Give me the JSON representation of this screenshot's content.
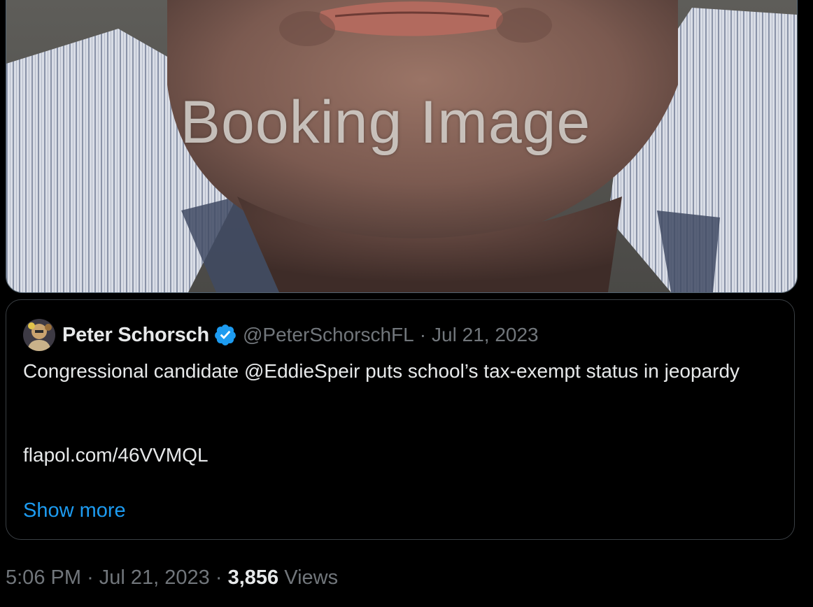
{
  "media": {
    "watermark_text": "Booking Image"
  },
  "quoted_tweet": {
    "author_name": "Peter Schorsch",
    "handle": "@PeterSchorschFL",
    "separator": "·",
    "date": "Jul 21, 2023",
    "text": "Congressional candidate @EddieSpeir puts school’s tax-exempt status in jeopardy",
    "link": "flapol.com/46VVMQL",
    "show_more_label": "Show more",
    "verified": true,
    "verified_color": "#1d9bf0"
  },
  "meta": {
    "time": "5:06 PM",
    "separator": "·",
    "date": "Jul 21, 2023",
    "views_count": "3,856",
    "views_label": "Views"
  },
  "colors": {
    "background": "#000000",
    "link": "#1d9bf0",
    "muted": "#71767b",
    "text": "#e7e9ea"
  },
  "icons": {
    "verified": "verified-badge-icon",
    "avatar": "avatar"
  }
}
